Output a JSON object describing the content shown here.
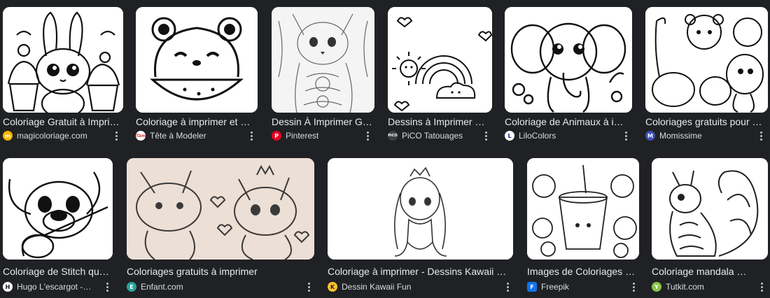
{
  "results": [
    {
      "title": "Coloriage Gratuit à Impri…",
      "source": "magicoloriage.com",
      "favicon_color": "#f4b400",
      "favicon_text": "m"
    },
    {
      "title": "Coloriage à imprimer et …",
      "source": "Tête à Modeler",
      "favicon_color": "#ffffff",
      "favicon_text": "Tàm"
    },
    {
      "title": "Dessin À Imprimer G…",
      "source": "Pinterest",
      "favicon_color": "#e60023",
      "favicon_text": "P"
    },
    {
      "title": "Dessins à Imprimer …",
      "source": "PiCO Tatouages",
      "favicon_color": "#3c4043",
      "favicon_text": "PiCO"
    },
    {
      "title": "Coloriage de Animaux à i…",
      "source": "LiloColors",
      "favicon_color": "#ffffff",
      "favicon_text": "L"
    },
    {
      "title": "Coloriages gratuits pour …",
      "source": "Momissime",
      "favicon_color": "#3f51b5",
      "favicon_text": "M"
    },
    {
      "title": "Coloriage de Stitch qu…",
      "source": "Hugo L'escargot -…",
      "favicon_color": "#ffffff",
      "favicon_text": "H"
    },
    {
      "title": "Coloriages gratuits à imprimer",
      "source": "Enfant.com",
      "favicon_color": "#26a69a",
      "favicon_text": "E"
    },
    {
      "title": "Coloriage à imprimer - Dessins Kawaii …",
      "source": "Dessin Kawaii Fun",
      "favicon_color": "#fbc02d",
      "favicon_text": "K"
    },
    {
      "title": "Images de Coloriages …",
      "source": "Freepik",
      "favicon_color": "#1273eb",
      "favicon_text": "F"
    },
    {
      "title": "Coloriage mandala grat…",
      "source": "Tutkit.com",
      "favicon_color": "#8bc34a",
      "favicon_text": "Y"
    }
  ]
}
